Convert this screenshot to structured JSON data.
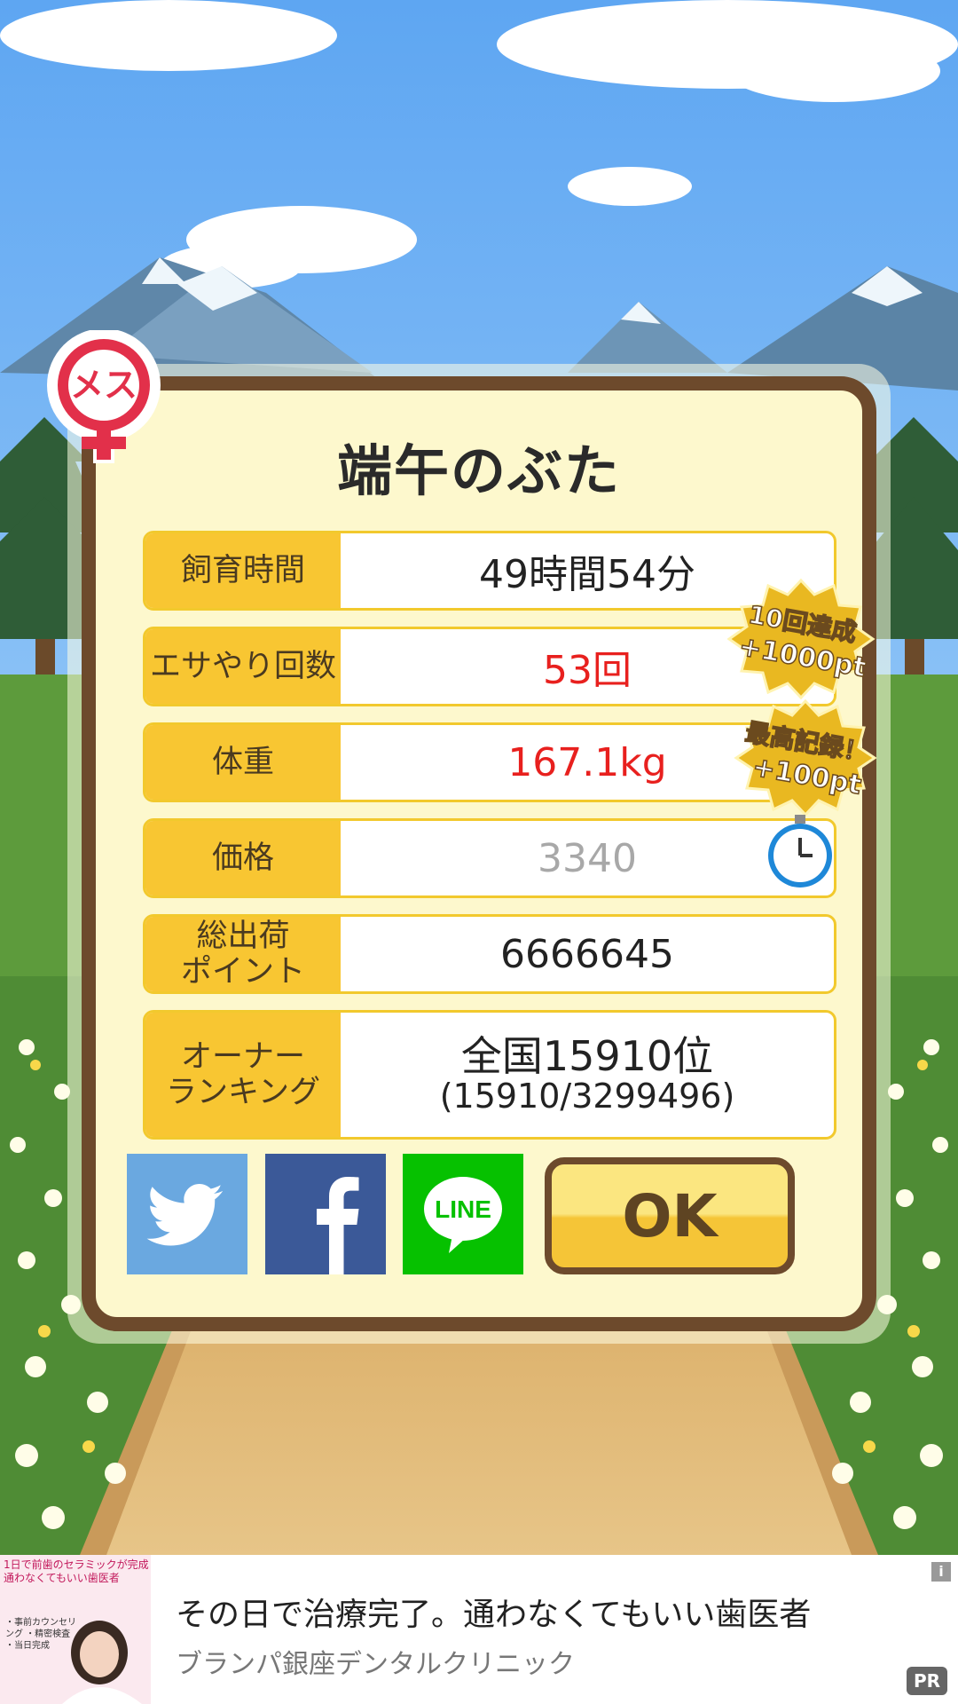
{
  "title": "端午のぶた",
  "gender_badge": "メス",
  "stats": [
    {
      "label": "飼育時間",
      "value": "49時間54分",
      "color": "#222222"
    },
    {
      "label": "エサやり回数",
      "value": "53回",
      "color": "#e8201e"
    },
    {
      "label": "体重",
      "value": "167.1kg",
      "color": "#e8201e"
    },
    {
      "label": "価格",
      "value": "3340",
      "color": "#a8a8a8"
    },
    {
      "label_line1": "総出荷",
      "label_line2": "ポイント",
      "value": "6666645",
      "color": "#222222"
    },
    {
      "label_line1": "オーナー",
      "label_line2": "ランキング",
      "value_line1": "全国15910位",
      "value_line2": "(15910/3299496)",
      "color": "#222222"
    }
  ],
  "badges": [
    {
      "line1": "10回達成",
      "line2": "+1000pt"
    },
    {
      "line1": "最高記録！",
      "line2": "+100pt"
    }
  ],
  "buttons": {
    "twitter": "twitter-icon",
    "facebook": "facebook-icon",
    "line": "LINE",
    "ok": "OK"
  },
  "ad": {
    "image_text": "1日で前歯のセラミックが完成 通わなくてもいい歯医者",
    "image_points": "・事前カウンセリング ・精密検査 ・当日完成",
    "title": "その日で治療完了。通わなくてもいい歯医者",
    "sponsor": "ブランパ銀座デンタルクリニック",
    "pr_label": "PR",
    "info_label": "i"
  },
  "colors": {
    "panel_border": "#6d4a2c",
    "panel_bg": "#fdf8cd",
    "label_bg": "#f8c632",
    "twitter": "#6aa8e0",
    "facebook": "#3b5998",
    "line": "#06c100"
  }
}
